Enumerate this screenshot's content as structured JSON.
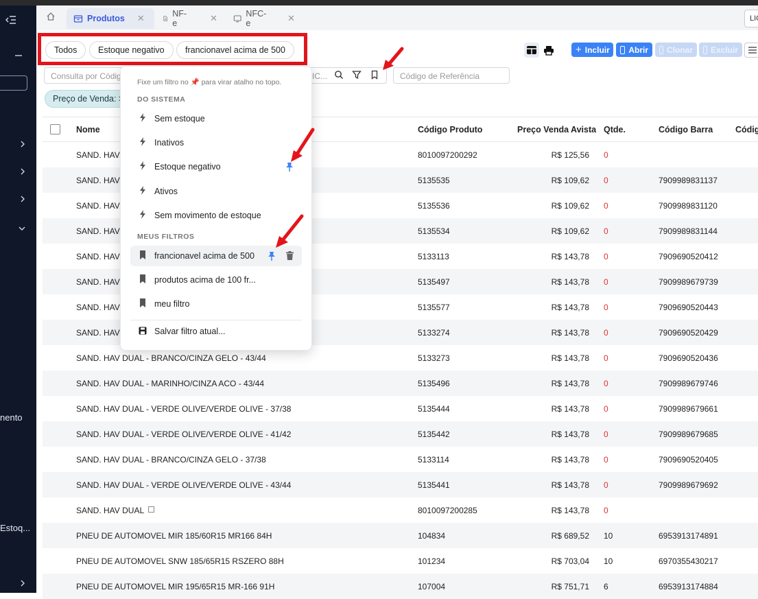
{
  "sidebar": {
    "labels": [
      "nento",
      "Estoq..."
    ]
  },
  "tabs": [
    {
      "label": "Produtos",
      "active": true
    },
    {
      "label": "NF-e",
      "active": false
    },
    {
      "label": "NFC-e",
      "active": false
    }
  ],
  "license_label": "LIC",
  "quick_filters": [
    "Todos",
    "Estoque negativo",
    "francionavel acima de 500"
  ],
  "actions": {
    "incluir": "Incluir",
    "abrir": "Abrir",
    "clonar": "Clonar",
    "excluir": "Excluir"
  },
  "search": {
    "placeholder": "Consulta por Códig",
    "suffix": "IC...",
    "ref_placeholder": "Código de Referência"
  },
  "active_filter_chip": "Preço de Venda: >",
  "dropdown": {
    "hint": "Fixe um filtro no 📌 para virar atalho no topo.",
    "system_title": "DO SISTEMA",
    "system_filters": [
      "Sem estoque",
      "Inativos",
      "Estoque negativo",
      "Ativos",
      "Sem movimento de estoque"
    ],
    "my_title": "MEUS FILTROS",
    "my_filters": [
      "francionavel acima de 500",
      "produtos acima de 100 fr...",
      "meu filtro"
    ],
    "save_label": "Salvar filtro atual..."
  },
  "table": {
    "headers": [
      "Nome",
      "Código Produto",
      "Preço Venda Avista",
      "Qtde.",
      "Código Barra",
      "Códig"
    ],
    "rows": [
      {
        "nome": "SAND. HAV.",
        "codigo": "8010097200292",
        "preco": "R$ 125,56",
        "qtde": "0",
        "barra": ""
      },
      {
        "nome": "SAND. HAV.",
        "codigo": "5135535",
        "preco": "R$ 109,62",
        "qtde": "0",
        "barra": "7909989831137"
      },
      {
        "nome": "SAND. HAV.",
        "codigo": "5135536",
        "preco": "R$ 109,62",
        "qtde": "0",
        "barra": "7909989831120"
      },
      {
        "nome": "SAND. HAV.",
        "codigo": "5135534",
        "preco": "R$ 109,62",
        "qtde": "0",
        "barra": "7909989831144"
      },
      {
        "nome": "SAND. HAV",
        "codigo": "5133113",
        "preco": "R$ 143,78",
        "qtde": "0",
        "barra": "7909690520412"
      },
      {
        "nome": "SAND. HAV",
        "codigo": "5135497",
        "preco": "R$ 143,78",
        "qtde": "0",
        "barra": "7909989679739"
      },
      {
        "nome": "SAND. HAV",
        "codigo": "5135577",
        "preco": "R$ 143,78",
        "qtde": "0",
        "barra": "7909690520443"
      },
      {
        "nome": "SAND. HAV",
        "codigo": "5133274",
        "preco": "R$ 143,78",
        "qtde": "0",
        "barra": "7909690520429"
      },
      {
        "nome": "SAND. HAV DUAL - BRANCO/CINZA GELO - 43/44",
        "codigo": "5133273",
        "preco": "R$ 143,78",
        "qtde": "0",
        "barra": "7909690520436"
      },
      {
        "nome": "SAND. HAV DUAL - MARINHO/CINZA ACO - 43/44",
        "codigo": "5135496",
        "preco": "R$ 143,78",
        "qtde": "0",
        "barra": "7909989679746"
      },
      {
        "nome": "SAND. HAV DUAL - VERDE OLIVE/VERDE OLIVE - 37/38",
        "codigo": "5135444",
        "preco": "R$ 143,78",
        "qtde": "0",
        "barra": "7909989679661"
      },
      {
        "nome": "SAND. HAV DUAL - VERDE OLIVE/VERDE OLIVE - 41/42",
        "codigo": "5135442",
        "preco": "R$ 143,78",
        "qtde": "0",
        "barra": "7909989679685"
      },
      {
        "nome": "SAND. HAV DUAL - BRANCO/CINZA GELO - 37/38",
        "codigo": "5133114",
        "preco": "R$ 143,78",
        "qtde": "0",
        "barra": "7909690520405"
      },
      {
        "nome": "SAND. HAV DUAL - VERDE OLIVE/VERDE OLIVE - 43/44",
        "codigo": "5135441",
        "preco": "R$ 143,78",
        "qtde": "0",
        "barra": "7909989679692"
      },
      {
        "nome": "SAND. HAV DUAL",
        "codigo": "8010097200285",
        "preco": "R$ 143,78",
        "qtde": "0",
        "barra": ""
      },
      {
        "nome": "PNEU DE AUTOMOVEL MIR 185/60R15 MR166 84H",
        "codigo": "104834",
        "preco": "R$ 689,52",
        "qtde": "10",
        "barra": "6953913174891"
      },
      {
        "nome": "PNEU DE AUTOMOVEL SNW 185/65R15 RSZERO 88H",
        "codigo": "101234",
        "preco": "R$ 703,04",
        "qtde": "10",
        "barra": "6970355430217"
      },
      {
        "nome": "PNEU DE AUTOMOVEL MIR 195/65R15 MR-166 91H",
        "codigo": "107004",
        "preco": "R$ 751,71",
        "qtde": "6",
        "barra": "6953913174884"
      }
    ]
  },
  "colors": {
    "sidebar": "#0f1729",
    "accent": "#3b82f6",
    "highlight_box": "#e3151b",
    "zero_qty": "#e03131"
  }
}
